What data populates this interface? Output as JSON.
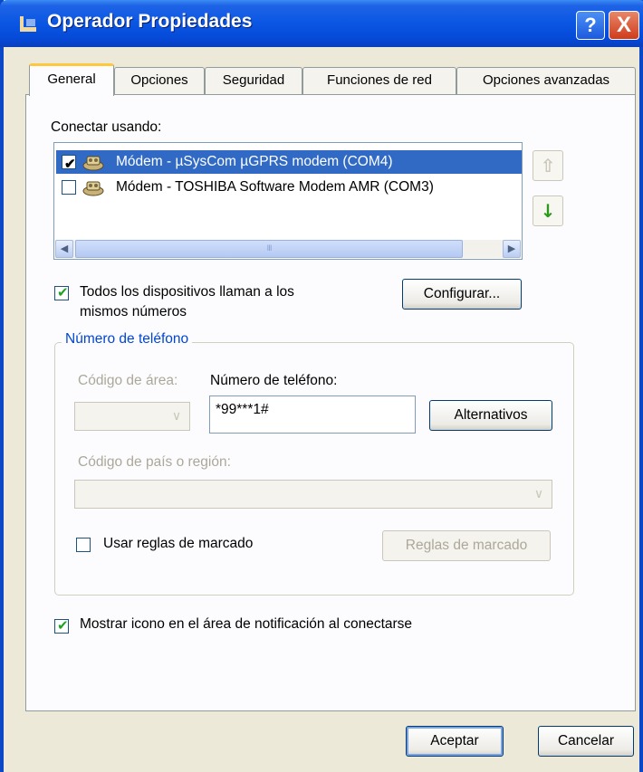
{
  "window": {
    "title": "Operador Propiedades"
  },
  "title_buttons": {
    "help": "?",
    "close": "X"
  },
  "tabs": [
    {
      "label": "General"
    },
    {
      "label": "Opciones"
    },
    {
      "label": "Seguridad"
    },
    {
      "label": "Funciones de red"
    },
    {
      "label": "Opciones avanzadas"
    }
  ],
  "active_tab": "General",
  "connect_using": {
    "label": "Conectar usando:",
    "devices": [
      {
        "name": "Módem - µSysCom µGPRS modem (COM4)",
        "checked": true,
        "selected": true
      },
      {
        "name": "Módem - TOSHIBA Software Modem AMR (COM3)",
        "checked": false,
        "selected": false
      }
    ],
    "scroll_thumb_grip": "III"
  },
  "move_up_icon": "up-arrow-icon",
  "move_down_icon": "down-arrow-icon",
  "all_devices": {
    "label_line1": "Todos los dispositivos llaman a los",
    "label_line2": "mismos números",
    "checked": true
  },
  "configure_button": "Configurar...",
  "phone_group": {
    "title": "Número de teléfono",
    "area_code_label": "Código de área:",
    "area_code_value": "",
    "phone_label": "Número de teléfono:",
    "phone_value": "*99***1#",
    "alternates_button": "Alternativos",
    "country_label": "Código de país o región:",
    "country_value": "",
    "dialing_rules_label": "Usar reglas de marcado",
    "dialing_rules_checked": false,
    "dialing_rules_button": "Reglas de marcado"
  },
  "show_icon": {
    "label": "Mostrar icono en el área de notificación al conectarse",
    "checked": true
  },
  "footer": {
    "ok": "Aceptar",
    "cancel": "Cancelar"
  },
  "colors": {
    "titlebar": "#0a56e3",
    "selection": "#316ac5",
    "group_title": "#0046d5",
    "check_mark": "#21a121"
  }
}
